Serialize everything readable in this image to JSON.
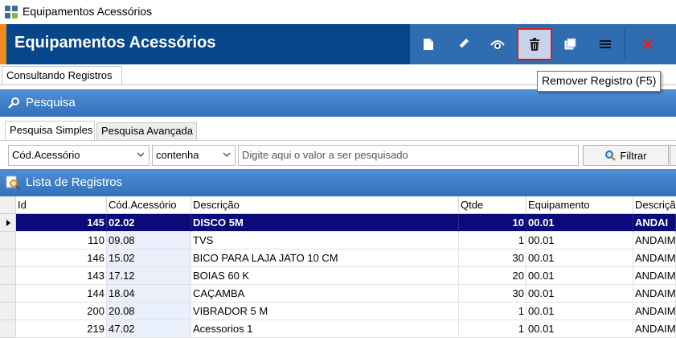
{
  "window": {
    "title": "Equipamentos Acessórios"
  },
  "header": {
    "title": "Equipamentos Acessórios"
  },
  "toolbar": {
    "buttons": [
      {
        "name": "new-button",
        "icon": "document-icon"
      },
      {
        "name": "edit-button",
        "icon": "pencil-icon"
      },
      {
        "name": "view-button",
        "icon": "eye-icon"
      },
      {
        "name": "remove-button",
        "icon": "trash-icon"
      },
      {
        "name": "copy-button",
        "icon": "stack-icon"
      },
      {
        "name": "menu-button",
        "icon": "hamburger-icon"
      },
      {
        "name": "close-button",
        "icon": "close-icon"
      }
    ],
    "highlight_color": "#e11b1b"
  },
  "tooltip": {
    "text": "Remover Registro (F5)"
  },
  "mode_tab": {
    "label": "Consultando Registros"
  },
  "search_section": {
    "title": "Pesquisa",
    "tabs": [
      {
        "label": "Pesquisa Simples"
      },
      {
        "label": "Pesquisa Avançada"
      }
    ],
    "field_select": "Cód.Acessório",
    "operator_select": "contenha",
    "input_placeholder": "Digite aqui o valor a ser pesquisado",
    "filter_button": "Filtrar"
  },
  "list_section": {
    "title": "Lista de Registros"
  },
  "grid": {
    "columns": [
      "Id",
      "Cód.Acessório",
      "Descrição",
      "Qtde",
      "Equipamento",
      "Descriçã"
    ],
    "rows": [
      {
        "id": "145",
        "cod": "02.02",
        "desc": "DISCO 5M",
        "qtde": "10",
        "equip": "00.01",
        "desc2": "ANDAI",
        "selected": true
      },
      {
        "id": "110",
        "cod": "09.08",
        "desc": "TVS",
        "qtde": "1",
        "equip": "00.01",
        "desc2": "ANDAIM"
      },
      {
        "id": "146",
        "cod": "15.02",
        "desc": "BICO PARA LAJA JATO 10 CM",
        "qtde": "30",
        "equip": "00.01",
        "desc2": "ANDAIM"
      },
      {
        "id": "143",
        "cod": "17.12",
        "desc": "BOIAS 60 K",
        "qtde": "20",
        "equip": "00.01",
        "desc2": "ANDAIM"
      },
      {
        "id": "144",
        "cod": "18.04",
        "desc": "CAÇAMBA",
        "qtde": "30",
        "equip": "00.01",
        "desc2": "ANDAIM"
      },
      {
        "id": "200",
        "cod": "20.08",
        "desc": "VIBRADOR 5 M",
        "qtde": "1",
        "equip": "00.01",
        "desc2": "ANDAIM"
      },
      {
        "id": "219",
        "cod": "47.02",
        "desc": "Acessorios 1",
        "qtde": "1",
        "equip": "00.01",
        "desc2": "ANDAIM"
      }
    ]
  }
}
